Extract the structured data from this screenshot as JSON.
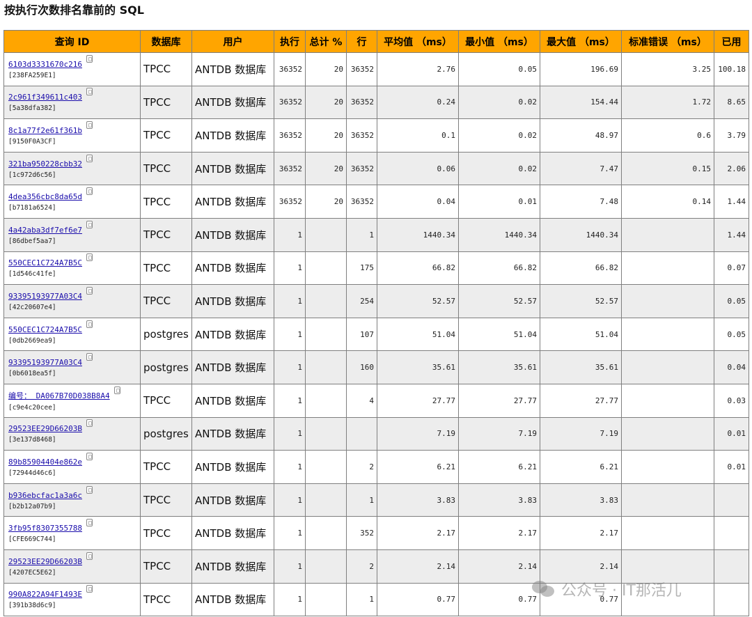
{
  "title": "按执行次数排名靠前的 SQL",
  "columns": [
    "查询 ID",
    "数据库",
    "用户",
    "执行",
    "总计 %",
    "行",
    "平均值 （ms）",
    "最小值 （ms）",
    "最大值 （ms）",
    "标准错误 （ms）",
    "已用"
  ],
  "rows": [
    {
      "id": "6103d3331670c216",
      "sub": "[238FA259E1]",
      "db": "TPCC",
      "user": "ANTDB 数据库",
      "exec": "36352",
      "total": "20",
      "rows": "36352",
      "avg": "2.76",
      "min": "0.05",
      "max": "196.69",
      "std": "3.25",
      "used": "100.18"
    },
    {
      "id": "2c961f349611c403",
      "sub": "[5a38dfa382]",
      "db": "TPCC",
      "user": "ANTDB 数据库",
      "exec": "36352",
      "total": "20",
      "rows": "36352",
      "avg": "0.24",
      "min": "0.02",
      "max": "154.44",
      "std": "1.72",
      "used": "8.65"
    },
    {
      "id": "8c1a77f2e61f361b",
      "sub": "[9150F0A3CF]",
      "db": "TPCC",
      "user": "ANTDB 数据库",
      "exec": "36352",
      "total": "20",
      "rows": "36352",
      "avg": "0.1",
      "min": "0.02",
      "max": "48.97",
      "std": "0.6",
      "used": "3.79"
    },
    {
      "id": "321ba950228cbb32",
      "sub": "[1c972d6c56]",
      "db": "TPCC",
      "user": "ANTDB 数据库",
      "exec": "36352",
      "total": "20",
      "rows": "36352",
      "avg": "0.06",
      "min": "0.02",
      "max": "7.47",
      "std": "0.15",
      "used": "2.06"
    },
    {
      "id": "4dea356cbc8da65d",
      "sub": "[b7181a6524]",
      "db": "TPCC",
      "user": "ANTDB 数据库",
      "exec": "36352",
      "total": "20",
      "rows": "36352",
      "avg": "0.04",
      "min": "0.01",
      "max": "7.48",
      "std": "0.14",
      "used": "1.44"
    },
    {
      "id": "4a42aba3df7ef6e7",
      "sub": "[86dbef5aa7]",
      "db": "TPCC",
      "user": "ANTDB 数据库",
      "exec": "1",
      "total": "",
      "rows": "1",
      "avg": "1440.34",
      "min": "1440.34",
      "max": "1440.34",
      "std": "",
      "used": "1.44"
    },
    {
      "id": "550CEC1C724A7B5C",
      "sub": "[1d546c41fe]",
      "db": "TPCC",
      "user": "ANTDB 数据库",
      "exec": "1",
      "total": "",
      "rows": "175",
      "avg": "66.82",
      "min": "66.82",
      "max": "66.82",
      "std": "",
      "used": "0.07"
    },
    {
      "id": "93395193977A03C4",
      "sub": "[42c20607e4]",
      "db": "TPCC",
      "user": "ANTDB 数据库",
      "exec": "1",
      "total": "",
      "rows": "254",
      "avg": "52.57",
      "min": "52.57",
      "max": "52.57",
      "std": "",
      "used": "0.05"
    },
    {
      "id": "550CEC1C724A7B5C",
      "sub": "[0db2669ea9]",
      "db": "postgres",
      "user": "ANTDB 数据库",
      "exec": "1",
      "total": "",
      "rows": "107",
      "avg": "51.04",
      "min": "51.04",
      "max": "51.04",
      "std": "",
      "used": "0.05"
    },
    {
      "id": "93395193977A03C4",
      "sub": "[0b6018ea5f]",
      "db": "postgres",
      "user": "ANTDB 数据库",
      "exec": "1",
      "total": "",
      "rows": "160",
      "avg": "35.61",
      "min": "35.61",
      "max": "35.61",
      "std": "",
      "used": "0.04"
    },
    {
      "id": "编号： DA067B70D038B8A4",
      "sub": "[c9e4c20cee]",
      "db": "TPCC",
      "user": "ANTDB 数据库",
      "exec": "1",
      "total": "",
      "rows": "4",
      "avg": "27.77",
      "min": "27.77",
      "max": "27.77",
      "std": "",
      "used": "0.03"
    },
    {
      "id": "29523EE29D66203B",
      "sub": "[3e137d8468]",
      "db": "postgres",
      "user": "ANTDB 数据库",
      "exec": "1",
      "total": "",
      "rows": "",
      "avg": "7.19",
      "min": "7.19",
      "max": "7.19",
      "std": "",
      "used": "0.01"
    },
    {
      "id": "89b85904404e862e",
      "sub": "[72944d46c6]",
      "db": "TPCC",
      "user": "ANTDB 数据库",
      "exec": "1",
      "total": "",
      "rows": "2",
      "avg": "6.21",
      "min": "6.21",
      "max": "6.21",
      "std": "",
      "used": "0.01"
    },
    {
      "id": "b936ebcfac1a3a6c",
      "sub": "[b2b12a07b9]",
      "db": "TPCC",
      "user": "ANTDB 数据库",
      "exec": "1",
      "total": "",
      "rows": "1",
      "avg": "3.83",
      "min": "3.83",
      "max": "3.83",
      "std": "",
      "used": ""
    },
    {
      "id": "3fb95f8307355788",
      "sub": "[CFE669C744]",
      "db": "TPCC",
      "user": "ANTDB 数据库",
      "exec": "1",
      "total": "",
      "rows": "352",
      "avg": "2.17",
      "min": "2.17",
      "max": "2.17",
      "std": "",
      "used": ""
    },
    {
      "id": "29523EE29D66203B",
      "sub": "[4207EC5E62]",
      "db": "TPCC",
      "user": "ANTDB 数据库",
      "exec": "1",
      "total": "",
      "rows": "2",
      "avg": "2.14",
      "min": "2.14",
      "max": "2.14",
      "std": "",
      "used": ""
    },
    {
      "id": "990A822A94F1493E",
      "sub": "[391b38d6c9]",
      "db": "TPCC",
      "user": "ANTDB 数据库",
      "exec": "1",
      "total": "",
      "rows": "1",
      "avg": "0.77",
      "min": "0.77",
      "max": "0.77",
      "std": "",
      "used": ""
    }
  ],
  "watermark": "公众号 · IT那活儿",
  "icons": {
    "copy": "copy-icon",
    "watermark": "wechat-icon"
  },
  "colors": {
    "header_bg": "#ffa500",
    "row_alt": "#ededed",
    "link": "#1a0dab"
  }
}
